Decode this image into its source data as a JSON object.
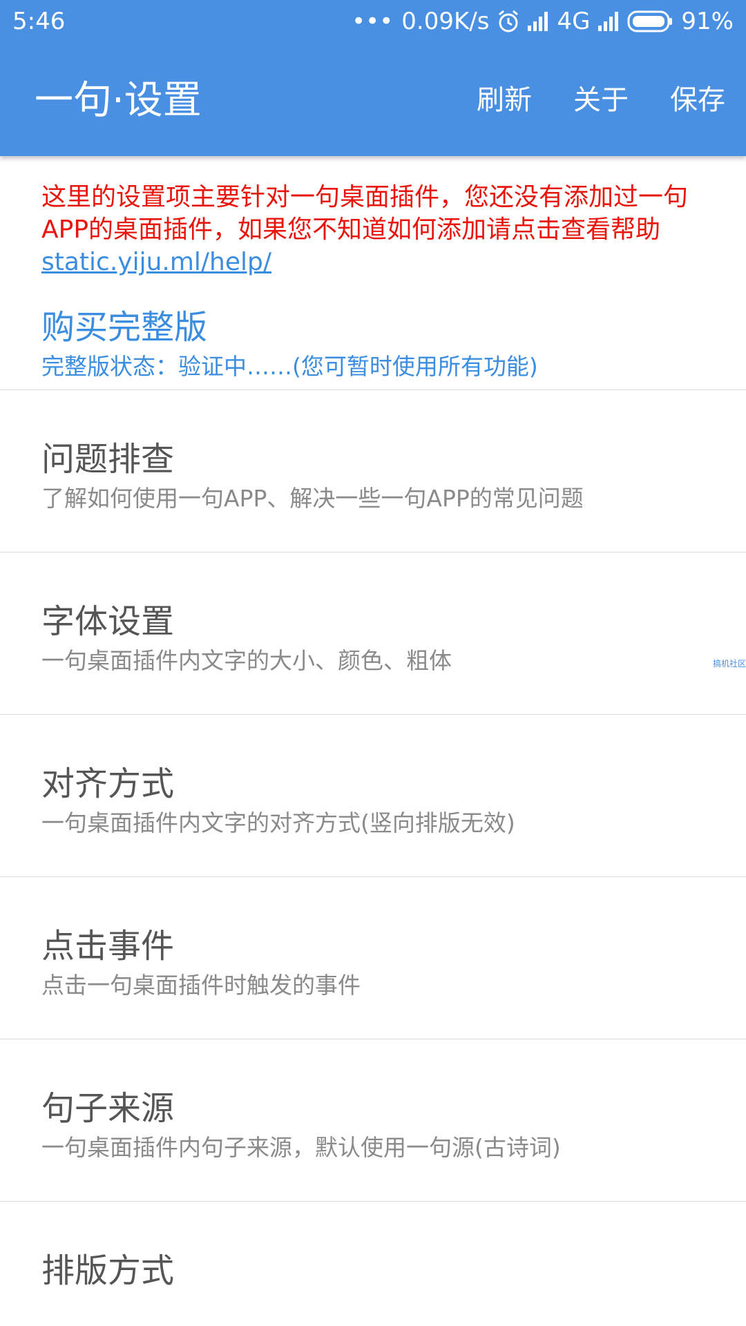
{
  "status_bar": {
    "time": "5:46",
    "dots": "•••",
    "net_speed": "0.09K/s",
    "network": "4G",
    "battery": "91%"
  },
  "toolbar": {
    "title": "一句·设置",
    "actions": {
      "refresh": "刷新",
      "about": "关于",
      "save": "保存"
    }
  },
  "notice": {
    "text": "这里的设置项主要针对一句桌面插件，您还没有添加过一句APP的桌面插件，如果您不知道如何添加请点击查看帮助 ",
    "link": "static.yiju.ml/help/"
  },
  "buy": {
    "title": "购买完整版",
    "summary": "完整版状态：验证中……(您可暂时使用所有功能)"
  },
  "items": [
    {
      "title": "问题排查",
      "summary": "了解如何使用一句APP、解决一些一句APP的常见问题"
    },
    {
      "title": "字体设置",
      "summary": "一句桌面插件内文字的大小、颜色、粗体"
    },
    {
      "title": "对齐方式",
      "summary": "一句桌面插件内文字的对齐方式(竖向排版无效)"
    },
    {
      "title": "点击事件",
      "summary": "点击一句桌面插件时触发的事件"
    },
    {
      "title": "句子来源",
      "summary": "一句桌面插件内句子来源，默认使用一句源(古诗词)"
    },
    {
      "title": "排版方式",
      "summary": ""
    }
  ],
  "watermark": "搞机社区"
}
